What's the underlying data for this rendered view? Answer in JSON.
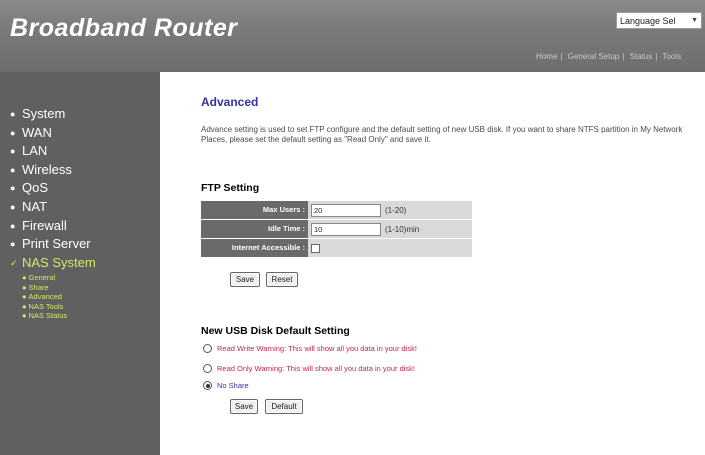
{
  "header": {
    "brand": "Broadband Router",
    "language_select": "Language Sel",
    "top_links": [
      "Home",
      "General Setup",
      "Status",
      "Tools"
    ]
  },
  "sidebar": {
    "items": [
      {
        "label": "System"
      },
      {
        "label": "WAN"
      },
      {
        "label": "LAN"
      },
      {
        "label": "Wireless"
      },
      {
        "label": "QoS"
      },
      {
        "label": "NAT"
      },
      {
        "label": "Firewall"
      },
      {
        "label": "Print Server"
      },
      {
        "label": "NAS System"
      }
    ],
    "subitems": [
      {
        "label": "General"
      },
      {
        "label": "Share"
      },
      {
        "label": "Advanced"
      },
      {
        "label": "NAS Tools"
      },
      {
        "label": "NAS Status"
      }
    ]
  },
  "main": {
    "title": "Advanced",
    "description": "Advance setting is used to set FTP configure and the default setting of new USB disk. If you want to share NTFS partition in My Network Places, please set the default setting as \"Read Only\" and save it.",
    "ftp_section_title": "FTP Setting",
    "ftp": {
      "max_users_label": "Max Users :",
      "max_users_value": "20",
      "max_users_hint": "(1-20)",
      "idle_time_label": "Idle Time :",
      "idle_time_value": "10",
      "idle_time_hint": "(1-10)min",
      "internet_accessible_label": "Internet Accessible :",
      "internet_accessible_checked": false
    },
    "ftp_buttons": {
      "save": "Save",
      "reset": "Reset"
    },
    "usb_section_title": "New USB Disk Default Setting",
    "usb_options": [
      {
        "label": "Read Write Warning: This will show all you data in your disk!",
        "checked": false
      },
      {
        "label": "Read Only Warning: This will show all you data in your disk!",
        "checked": false
      },
      {
        "label": "No Share",
        "checked": true
      }
    ],
    "usb_buttons": {
      "save": "Save",
      "default": "Default"
    }
  },
  "colors": {
    "header": "#7a7a7a",
    "sidebar": "#606060",
    "active_nav": "#d6e86a",
    "title": "#333399",
    "warning": "#cc2255"
  }
}
